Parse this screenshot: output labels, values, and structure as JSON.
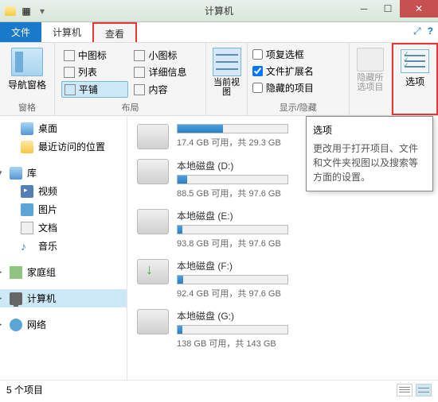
{
  "titlebar": {
    "title": "计算机"
  },
  "tabs": {
    "file": "文件",
    "computer": "计算机",
    "view": "查看"
  },
  "ribbon": {
    "navpane": {
      "label": "导航窗格",
      "group": "窗格"
    },
    "layout": {
      "items": [
        "中图标",
        "小图标",
        "列表",
        "详细信息",
        "平铺",
        "内容"
      ],
      "group": "布局"
    },
    "curview": {
      "label": "当前视图"
    },
    "showhide": {
      "checkbox1": "项复选框",
      "checkbox2": "文件扩展名",
      "checkbox3": "隐藏的项目",
      "hideitems": "隐藏所选项目",
      "group": "显示/隐藏"
    },
    "options": {
      "label": "选项"
    }
  },
  "sidebar": {
    "desktop": "桌面",
    "recent": "最近访问的位置",
    "library": "库",
    "video": "视频",
    "pictures": "图片",
    "documents": "文档",
    "music": "音乐",
    "homegroup": "家庭组",
    "computer": "计算机",
    "network": "网络"
  },
  "drives": [
    {
      "name": "",
      "used_pct": 41,
      "stats": "17.4 GB 可用，共 29.3 GB"
    },
    {
      "name": "本地磁盘 (D:)",
      "used_pct": 9,
      "stats": "88.5 GB 可用，共 97.6 GB"
    },
    {
      "name": "本地磁盘 (E:)",
      "used_pct": 4,
      "stats": "93.8 GB 可用，共 97.6 GB"
    },
    {
      "name": "本地磁盘 (F:)",
      "used_pct": 5,
      "stats": "92.4 GB 可用，共 97.6 GB",
      "dl": true
    },
    {
      "name": "本地磁盘 (G:)",
      "used_pct": 4,
      "stats": "138 GB 可用，共 143 GB"
    }
  ],
  "tooltip": {
    "title": "选项",
    "body": "更改用于打开项目、文件和文件夹视图以及搜索等方面的设置。"
  },
  "statusbar": {
    "count": "5 个项目"
  }
}
